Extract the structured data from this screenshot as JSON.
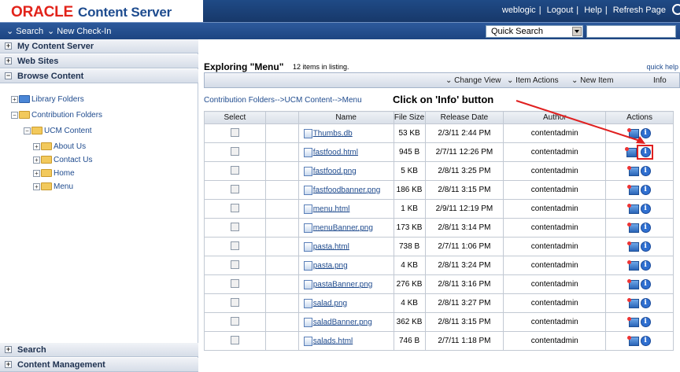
{
  "header": {
    "brand_oracle": "ORACLE",
    "brand_product": "Content Server",
    "links": [
      "weblogic",
      "Logout",
      "Help",
      "Refresh Page"
    ]
  },
  "menubar": {
    "search_label": "Search",
    "checkin_label": "New Check-In",
    "quick_search_value": "Quick Search"
  },
  "sidebar": {
    "sections_top": [
      {
        "label": "My Content Server",
        "toggle": "+"
      },
      {
        "label": "Web Sites",
        "toggle": "+"
      },
      {
        "label": "Browse Content",
        "toggle": "−"
      }
    ],
    "tree": [
      {
        "label": "Library Folders"
      },
      {
        "label": "Contribution Folders"
      },
      {
        "label": "UCM Content"
      },
      {
        "label": "About Us"
      },
      {
        "label": "Contact Us"
      },
      {
        "label": "Home"
      },
      {
        "label": "Menu"
      }
    ],
    "sections_bottom": [
      {
        "label": "Search",
        "toggle": "+"
      },
      {
        "label": "Content Management",
        "toggle": "+"
      }
    ]
  },
  "main": {
    "title": "Exploring \"Menu\"",
    "count_text": "12 items in listing.",
    "quick_help": "quick help",
    "toolbar": {
      "change_view": "Change View",
      "item_actions": "Item Actions",
      "new_item": "New Item",
      "info": "Info"
    },
    "breadcrumb": "Contribution Folders-->UCM Content-->Menu",
    "annotation": "Click on 'Info' button"
  },
  "table": {
    "headers": [
      "Select",
      "",
      "Name",
      "File Size",
      "Release Date",
      "Author",
      "Actions"
    ],
    "rows": [
      {
        "name": "Thumbs.db",
        "size": "53 KB",
        "date": "2/3/11 2:44 PM",
        "author": "contentadmin"
      },
      {
        "name": "fastfood.html",
        "size": "945 B",
        "date": "2/7/11 12:26 PM",
        "author": "contentadmin"
      },
      {
        "name": "fastfood.png",
        "size": "5 KB",
        "date": "2/8/11 3:25 PM",
        "author": "contentadmin"
      },
      {
        "name": "fastfoodbanner.png",
        "size": "186 KB",
        "date": "2/8/11 3:15 PM",
        "author": "contentadmin"
      },
      {
        "name": "menu.html",
        "size": "1 KB",
        "date": "2/9/11 12:19 PM",
        "author": "contentadmin"
      },
      {
        "name": "menuBanner.png",
        "size": "173 KB",
        "date": "2/8/11 3:14 PM",
        "author": "contentadmin"
      },
      {
        "name": "pasta.html",
        "size": "738 B",
        "date": "2/7/11 1:06 PM",
        "author": "contentadmin"
      },
      {
        "name": "pasta.png",
        "size": "4 KB",
        "date": "2/8/11 3:24 PM",
        "author": "contentadmin"
      },
      {
        "name": "pastaBanner.png",
        "size": "276 KB",
        "date": "2/8/11 3:16 PM",
        "author": "contentadmin"
      },
      {
        "name": "salad.png",
        "size": "4 KB",
        "date": "2/8/11 3:27 PM",
        "author": "contentadmin"
      },
      {
        "name": "saladBanner.png",
        "size": "362 KB",
        "date": "2/8/11 3:15 PM",
        "author": "contentadmin"
      },
      {
        "name": "salads.html",
        "size": "746 B",
        "date": "2/7/11 1:18 PM",
        "author": "contentadmin"
      }
    ]
  },
  "colors": {
    "brand_red": "#e2231a",
    "brand_blue": "#1e4c8f",
    "menubar": "#1d4581",
    "highlight": "#e02020"
  }
}
